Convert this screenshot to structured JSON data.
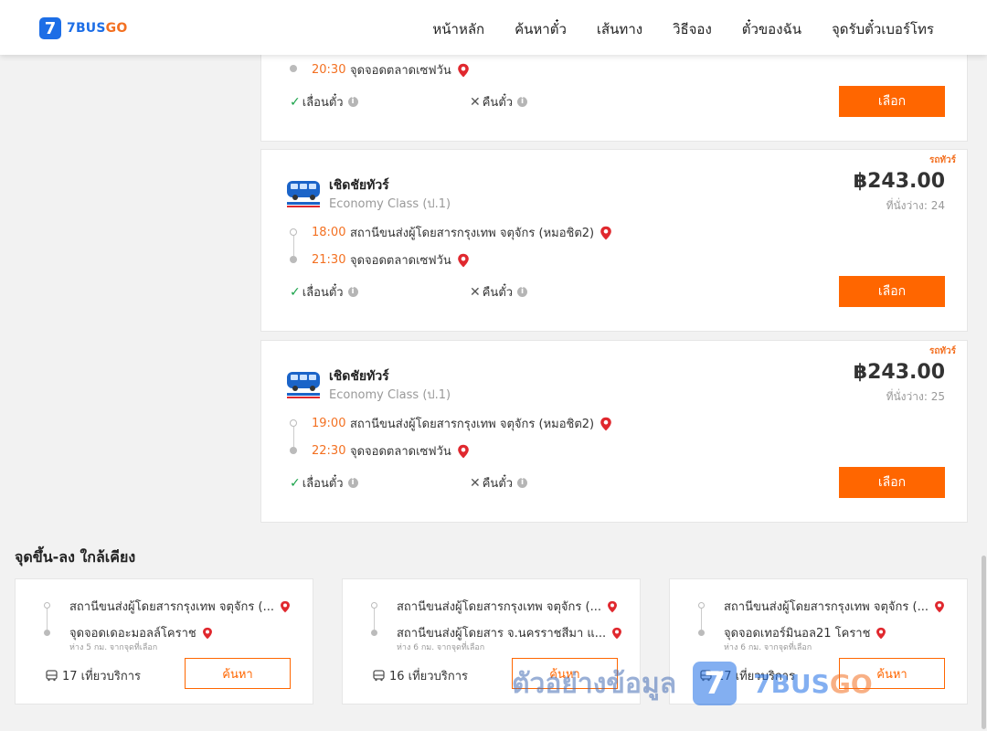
{
  "header": {
    "logo_text_a": "7BUS",
    "logo_text_b": "GO",
    "logo_number": "7",
    "nav": [
      "หน้าหลัก",
      "ค้นหาตั๋ว",
      "เส้นทาง",
      "วิธีจอง",
      "ตั๋วของฉัน",
      "จุดรับตั๋วเบอร์โทร"
    ]
  },
  "results": [
    {
      "arrival_time": "20:30",
      "arrival_place": "จุดจอดตลาดเซฟวัน",
      "change_label": "เลื่อนตั๋ว",
      "refund_label": "คืนตั๋ว",
      "select_label": "เลือก"
    },
    {
      "badge": "รถทัวร์",
      "operator": "เชิดชัยทัวร์",
      "class": "Economy Class (ป.1)",
      "price": "฿243.00",
      "seats": "ที่นั่งว่าง: 24",
      "departure_time": "18:00",
      "departure_place": "สถานีขนส่งผู้โดยสารกรุงเทพ จตุจักร (หมอชิต2)",
      "arrival_time": "21:30",
      "arrival_place": "จุดจอดตลาดเซฟวัน",
      "change_label": "เลื่อนตั๋ว",
      "refund_label": "คืนตั๋ว",
      "select_label": "เลือก"
    },
    {
      "badge": "รถทัวร์",
      "operator": "เชิดชัยทัวร์",
      "class": "Economy Class (ป.1)",
      "price": "฿243.00",
      "seats": "ที่นั่งว่าง: 25",
      "departure_time": "19:00",
      "departure_place": "สถานีขนส่งผู้โดยสารกรุงเทพ จตุจักร (หมอชิต2)",
      "arrival_time": "22:30",
      "arrival_place": "จุดจอดตลาดเซฟวัน",
      "change_label": "เลื่อนตั๋ว",
      "refund_label": "คืนตั๋ว",
      "select_label": "เลือก"
    }
  ],
  "nearby": {
    "title": "จุดขึ้น-ลง ใกล้เคียง",
    "items": [
      {
        "from": "สถานีขนส่งผู้โดยสารกรุงเทพ จตุจักร (...",
        "to": "จุดจอดเดอะมอลล์โคราช",
        "distance": "ห่าง 5 กม. จากจุดที่เลือก",
        "trips": "17 เที่ยวบริการ",
        "search_label": "ค้นหา"
      },
      {
        "from": "สถานีขนส่งผู้โดยสารกรุงเทพ จตุจักร (...",
        "to": "สถานีขนส่งผู้โดยสาร จ.นครราชสีมา แ...",
        "distance": "ห่าง 6 กม. จากจุดที่เลือก",
        "trips": "16 เที่ยวบริการ",
        "search_label": "ค้นหา"
      },
      {
        "from": "สถานีขนส่งผู้โดยสารกรุงเทพ จตุจักร (...",
        "to": "จุดจอดเทอร์มินอล21 โคราช",
        "distance": "ห่าง 6 กม. จากจุดที่เลือก",
        "trips": "17 เที่ยวบริการ",
        "search_label": "ค้นหา"
      }
    ]
  },
  "watermark": {
    "text": "ตัวอย่างข้อมูล",
    "badge": "7",
    "brand_a": "7BUS",
    "brand_b": "GO"
  },
  "colors": {
    "accent": "#ff6600",
    "time": "#f37021",
    "brand_blue": "#1d6ee6",
    "pin": "#e0282e",
    "check": "#1aa34a"
  }
}
